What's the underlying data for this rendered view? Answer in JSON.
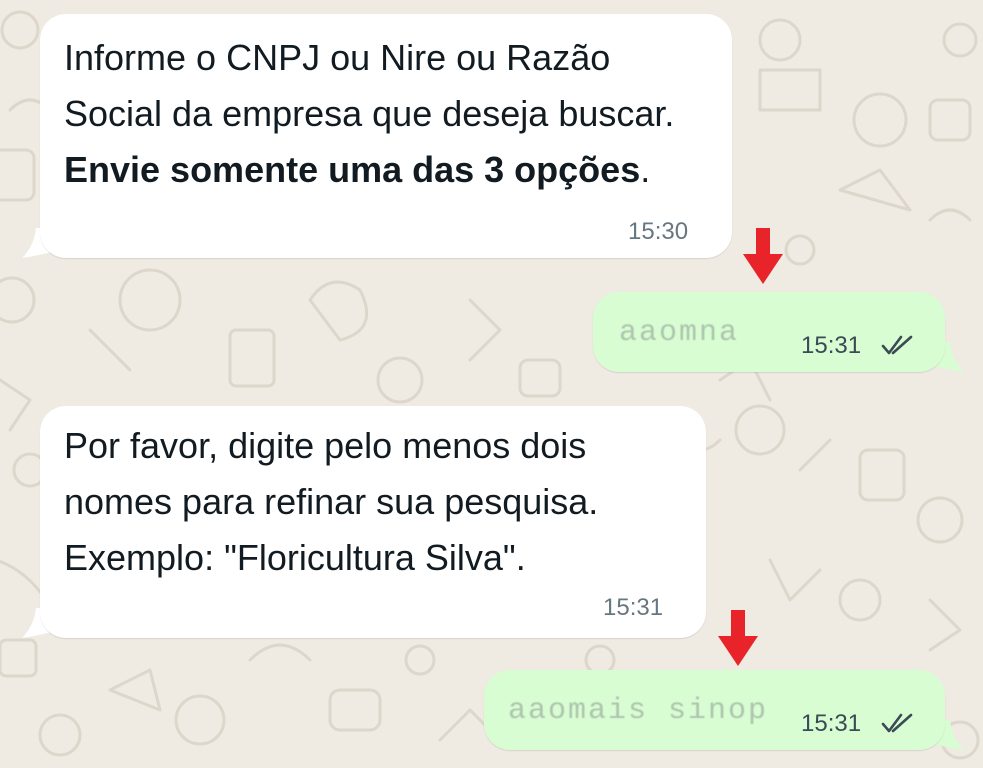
{
  "chat": {
    "messages": [
      {
        "direction": "incoming",
        "text_plain": "Informe o CNPJ ou Nire ou Razão Social da empresa que deseja buscar. ",
        "text_bold": "Envie somente uma das 3 opções",
        "text_suffix": ".",
        "time": "15:30"
      },
      {
        "direction": "outgoing",
        "text": "aaomna",
        "time": "15:31",
        "status": "read"
      },
      {
        "direction": "incoming",
        "text": "Por favor, digite pelo menos dois nomes para refinar sua pesquisa. Exemplo: \"Floricultura Silva\".",
        "time": "15:31"
      },
      {
        "direction": "outgoing",
        "text": "aaomais sinop",
        "time": "15:31",
        "status": "read"
      }
    ]
  },
  "colors": {
    "background": "#efeae2",
    "incoming_bubble": "#ffffff",
    "outgoing_bubble": "#d9fdd3",
    "arrow_annotation": "#e8232a",
    "read_ticks": "#3b4a54"
  },
  "icons": {
    "read_status": "double-check-icon",
    "annotation": "red-down-arrow-icon"
  }
}
